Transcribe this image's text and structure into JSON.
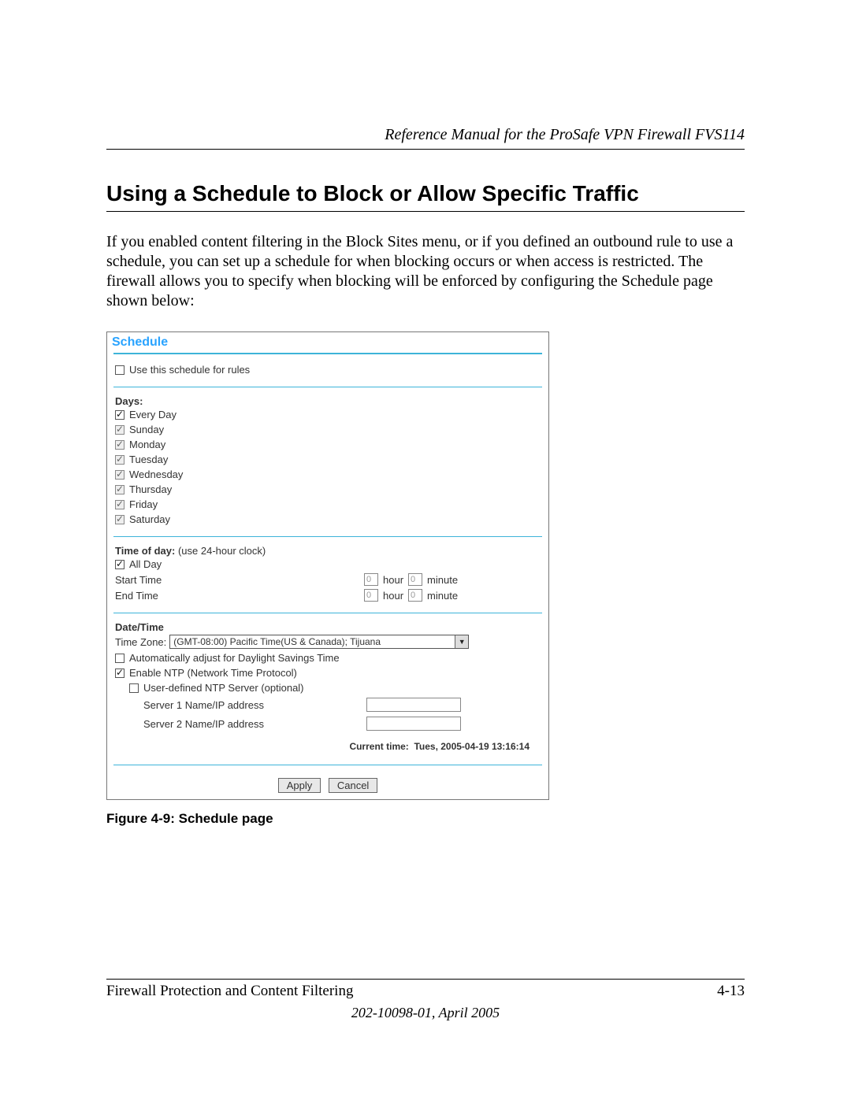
{
  "header": {
    "manual_title": "Reference Manual for the ProSafe VPN Firewall FVS114"
  },
  "section": {
    "title": "Using a Schedule to Block or Allow Specific Traffic",
    "paragraph": "If you enabled content filtering in the Block Sites menu, or if you defined an outbound rule to use a schedule, you can set up a schedule for when blocking occurs or when access is restricted. The firewall allows you to specify when blocking will be enforced by configuring the Schedule page shown below:"
  },
  "figure": {
    "panel_title": "Schedule",
    "use_schedule_label": "Use this schedule for rules",
    "days_header": "Days:",
    "days": [
      "Every Day",
      "Sunday",
      "Monday",
      "Tuesday",
      "Wednesday",
      "Thursday",
      "Friday",
      "Saturday"
    ],
    "time_header_prefix": "Time of day:",
    "time_header_note": " (use 24-hour clock)",
    "all_day_label": "All Day",
    "start_label": "Start Time",
    "end_label": "End Time",
    "hour_value": "0",
    "hour_unit": "hour",
    "minute_value": "0",
    "minute_unit": "minute",
    "datetime_header": "Date/Time",
    "tz_label": "Time Zone:",
    "tz_value": "(GMT-08:00) Pacific Time(US & Canada); Tijuana",
    "dst_label": "Automatically adjust for Daylight Savings Time",
    "ntp_label": "Enable NTP (Network Time Protocol)",
    "user_ntp_label": "User-defined NTP Server (optional)",
    "server1_label": "Server 1 Name/IP address",
    "server2_label": "Server 2 Name/IP address",
    "current_time_label": "Current time:",
    "current_time_value": "Tues, 2005-04-19 13:16:14",
    "apply_btn": "Apply",
    "cancel_btn": "Cancel",
    "caption": "Figure 4-9:  Schedule page"
  },
  "footer": {
    "chapter": "Firewall Protection and Content Filtering",
    "page": "4-13",
    "docnum": "202-10098-01, April 2005"
  }
}
